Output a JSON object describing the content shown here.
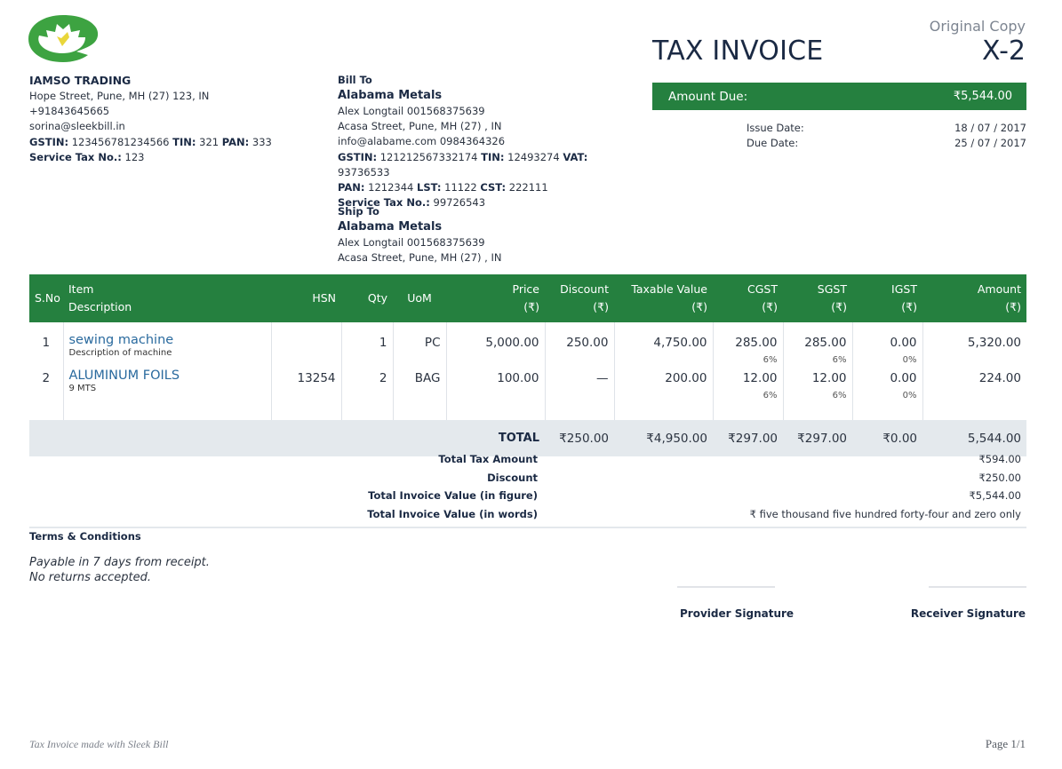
{
  "header": {
    "copy_label": "Original Copy",
    "title": "TAX INVOICE",
    "invoice_number": "X-2",
    "amount_due_label": "Amount Due:",
    "amount_due_value": "₹5,544.00",
    "issue_date_label": "Issue Date:",
    "issue_date": "18 / 07 / 2017",
    "due_date_label": "Due Date:",
    "due_date": "25 / 07 / 2017",
    "brand_colors": {
      "green": "#25803f",
      "navy": "#1b2a44",
      "yellow": "#e9d63a"
    }
  },
  "seller": {
    "logo_icon": "lotus-leaf-logo-icon",
    "name": "IAMSO TRADING",
    "address": "Hope Street, Pune, MH (27) 123, IN",
    "phone": "+91843645665",
    "email": "sorina@sleekbill.in",
    "gstin_label": "GSTIN:",
    "gstin": "123456781234566",
    "tin_label": "TIN:",
    "tin": "321",
    "pan_label": "PAN:",
    "pan": "333",
    "service_tax_label": "Service Tax No.:",
    "service_tax": "123"
  },
  "bill_to": {
    "label": "Bill To",
    "name": "Alabama Metals",
    "contact": "Alex Longtail 001568375639",
    "address": "Acasa Street, Pune, MH (27) , IN",
    "email_phone": "info@alabame.com 0984364326",
    "gstin_label": "GSTIN:",
    "gstin": "121212567332174",
    "tin_label": "TIN:",
    "tin": "12493274",
    "vat_label": "VAT:",
    "vat": "93736533",
    "pan_label": "PAN:",
    "pan": "1212344",
    "lst_label": "LST:",
    "lst": "11122",
    "cst_label": "CST:",
    "cst": "222111",
    "service_tax_label": "Service Tax No.:",
    "service_tax": "99726543"
  },
  "ship_to": {
    "label": "Ship To",
    "name": "Alabama Metals",
    "contact": "Alex Longtail 001568375639",
    "address": "Acasa Street, Pune, MH (27) , IN"
  },
  "table": {
    "headers": {
      "sno": "S.No",
      "item": [
        "Item",
        "Description"
      ],
      "hsn": "HSN",
      "qty": "Qty",
      "uom": "UoM",
      "price": [
        "Price",
        "(₹)"
      ],
      "discount": [
        "Discount",
        "(₹)"
      ],
      "taxable": [
        "Taxable Value",
        "(₹)"
      ],
      "cgst": [
        "CGST",
        "(₹)"
      ],
      "sgst": [
        "SGST",
        "(₹)"
      ],
      "igst": [
        "IGST",
        "(₹)"
      ],
      "amount": [
        "Amount",
        "(₹)"
      ]
    },
    "rows": [
      {
        "sno": "1",
        "name": "sewing machine",
        "desc": "Description of machine",
        "hsn": "",
        "qty": "1",
        "uom": "PC",
        "price": "5,000.00",
        "discount": "250.00",
        "taxable": "4,750.00",
        "cgst": "285.00",
        "cgst_rate": "6%",
        "sgst": "285.00",
        "sgst_rate": "6%",
        "igst": "0.00",
        "igst_rate": "0%",
        "amount": "5,320.00"
      },
      {
        "sno": "2",
        "name": "ALUMINUM FOILS",
        "desc": "9 MTS",
        "hsn": "13254",
        "qty": "2",
        "uom": "BAG",
        "price": "100.00",
        "discount": "—",
        "taxable": "200.00",
        "cgst": "12.00",
        "cgst_rate": "6%",
        "sgst": "12.00",
        "sgst_rate": "6%",
        "igst": "0.00",
        "igst_rate": "0%",
        "amount": "224.00"
      }
    ],
    "total": {
      "label": "TOTAL",
      "discount": "₹250.00",
      "taxable": "₹4,950.00",
      "cgst": "₹297.00",
      "sgst": "₹297.00",
      "igst": "₹0.00",
      "amount": "5,544.00"
    }
  },
  "summary": [
    {
      "label": "Total Tax Amount",
      "value": "₹594.00"
    },
    {
      "label": "Discount",
      "value": "₹250.00"
    },
    {
      "label": "Total Invoice Value (in figure)",
      "value": "₹5,544.00"
    },
    {
      "label": "Total Invoice Value (in words)",
      "value": "₹ five thousand five hundred forty-four and zero only"
    }
  ],
  "terms": {
    "title": "Terms & Conditions",
    "lines": [
      "Payable in 7 days from receipt.",
      "No returns accepted."
    ]
  },
  "signatures": {
    "provider": "Provider Signature",
    "receiver": "Receiver Signature"
  },
  "footer": {
    "left": "Tax Invoice made with Sleek Bill",
    "page": "Page 1/1"
  }
}
